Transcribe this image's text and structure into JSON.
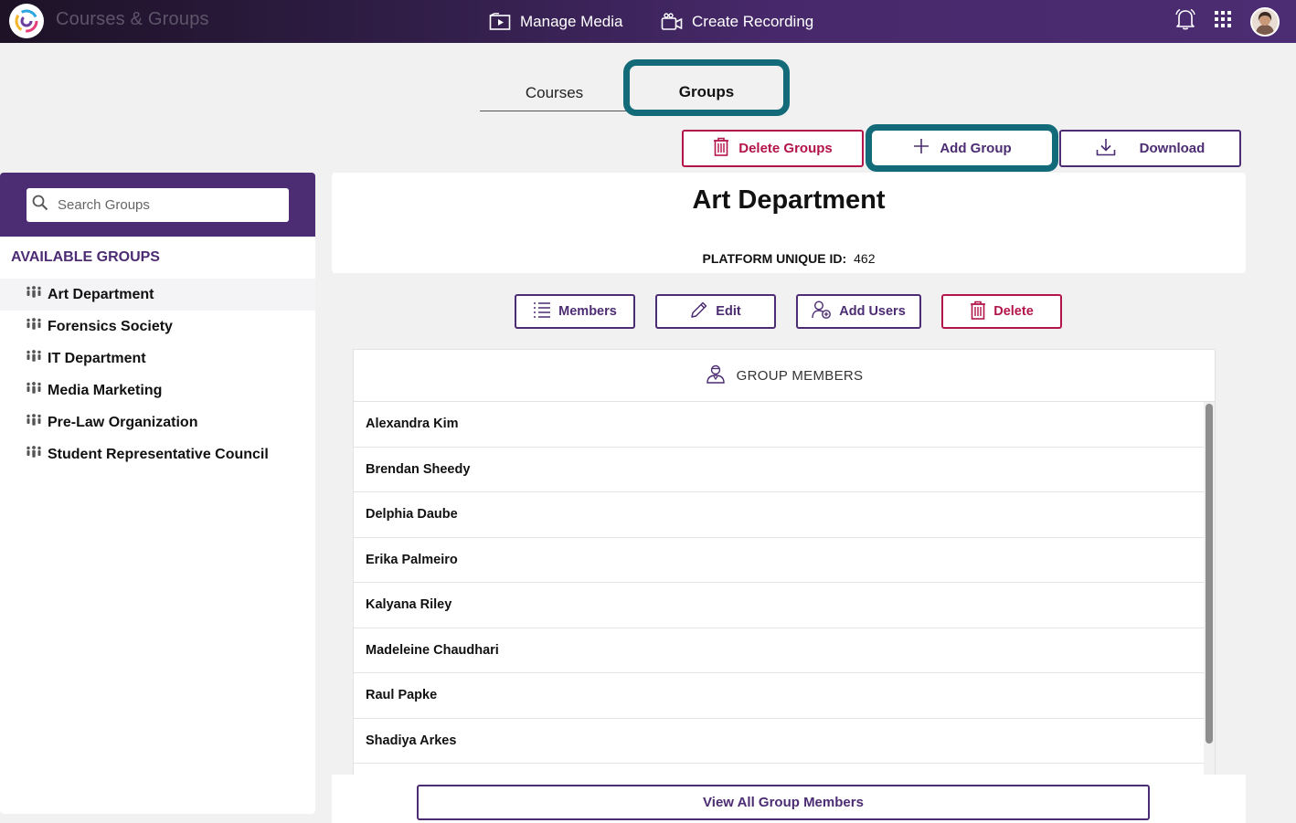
{
  "topbar": {
    "app_title": "Courses & Groups",
    "logo_icon": "spiral-logo-icon",
    "nav": [
      {
        "label": "Manage Media",
        "icon": "media-play-icon"
      },
      {
        "label": "Create Recording",
        "icon": "video-camera-icon"
      }
    ],
    "icons": [
      "bell-icon",
      "app-grid-icon",
      "user-avatar"
    ]
  },
  "tabs": {
    "courses": "Courses",
    "groups": "Groups",
    "active": "groups"
  },
  "toolbar": {
    "delete_groups": "Delete Groups",
    "add_group": "Add Group",
    "download": "Download"
  },
  "sidebar": {
    "search_placeholder": "Search Groups",
    "title": "AVAILABLE GROUPS",
    "groups": [
      {
        "label": "Art Department",
        "active": true
      },
      {
        "label": "Forensics Society"
      },
      {
        "label": "IT Department"
      },
      {
        "label": "Media Marketing"
      },
      {
        "label": "Pre-Law Organization"
      },
      {
        "label": "Student Representative Council"
      }
    ]
  },
  "detail": {
    "title": "Art Department",
    "puid_label": "PLATFORM UNIQUE ID:",
    "puid_value": "462",
    "actions": {
      "members": "Members",
      "edit": "Edit",
      "add_users": "Add Users",
      "delete": "Delete"
    },
    "members_title": "GROUP MEMBERS",
    "members": [
      "Alexandra Kim",
      "Brendan Sheedy",
      "Delphia Daube",
      "Erika Palmeiro",
      "Kalyana Riley",
      "Madeleine Chaudhari",
      "Raul Papke",
      "Shadiya Arkes"
    ],
    "view_all": "View All Group Members"
  },
  "colors": {
    "brand_purple": "#4c2c72",
    "danger": "#b3154a",
    "highlight_teal": "#136a79"
  }
}
